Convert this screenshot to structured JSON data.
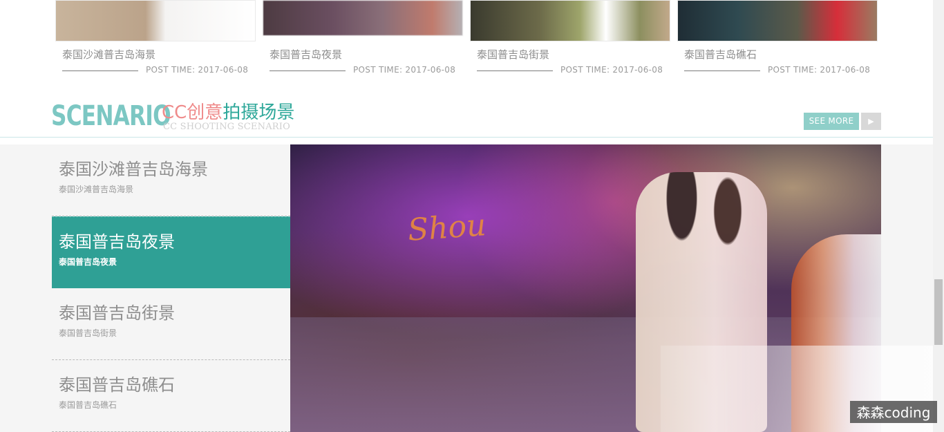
{
  "gallery": [
    {
      "title": "泰国沙滩普吉岛海景",
      "post_time": "POST TIME: 2017-06-08"
    },
    {
      "title": "泰国普吉岛夜景",
      "post_time": "POST TIME: 2017-06-08"
    },
    {
      "title": "泰国普吉岛街景",
      "post_time": "POST TIME: 2017-06-08"
    },
    {
      "title": "泰国普吉岛礁石",
      "post_time": "POST TIME: 2017-06-08"
    }
  ],
  "section": {
    "word": "SCENARIO",
    "cn_title_pink": "CC创意",
    "cn_title_teal": "拍摄场景",
    "en_subtitle": "CC SHOOTING SCENARIO",
    "see_more": "SEE MORE",
    "arrow_icon": "arrow-right-icon"
  },
  "menu": [
    {
      "title": "泰国沙滩普吉岛海景",
      "subtitle": "泰国沙滩普吉岛海景",
      "active": false
    },
    {
      "title": "泰国普吉岛夜景",
      "subtitle": "泰国普吉岛夜景",
      "active": true
    },
    {
      "title": "泰国普吉岛街景",
      "subtitle": "泰国普吉岛街景",
      "active": false
    },
    {
      "title": "泰国普吉岛礁石",
      "subtitle": "泰国普吉岛礁石",
      "active": false
    }
  ],
  "watermark": "森森coding",
  "colors": {
    "accent_teal": "#2fa095",
    "scenario_teal": "#7cc7c3",
    "pink": "#ef8b8b",
    "see_more_bg": "#8fcfc9"
  }
}
